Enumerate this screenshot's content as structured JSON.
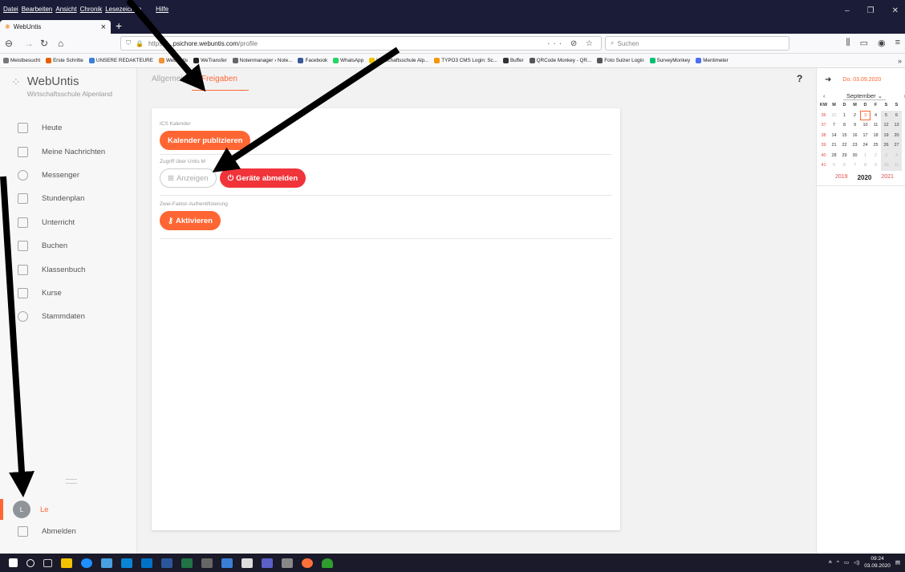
{
  "browser": {
    "menu": [
      "Datei",
      "Bearbeiten",
      "Ansicht",
      "Chronik",
      "Lesezeichen",
      "Hilfe"
    ],
    "tab_title": "WebUntis",
    "url_prefix": "https://",
    "url_host": "...psichore.webuntis.com",
    "url_path": "/profile",
    "search_placeholder": "Suchen",
    "bookmarks": [
      "Meistbesucht",
      "Erste Schritte",
      "UNSERE REDAKTEURE",
      "WebUntis",
      "WeTransfer",
      "Notenmanager › Note...",
      "Facebook",
      "WhatsApp",
      "Wirtschaftsschule Alp...",
      "TYPO3 CMS Login: Sc...",
      "Buffer",
      "QRCode Monkey - QR...",
      "Foto Sulzer Login",
      "SurveyMonkey",
      "Mentimeter"
    ],
    "more": "»"
  },
  "app": {
    "logo_title": "WebUntis",
    "logo_subtitle": "Wirtschaftsschule Alpenland",
    "nav": [
      "Heute",
      "Meine Nachrichten",
      "Messenger",
      "Stundenplan",
      "Unterricht",
      "Buchen",
      "Klassenbuch",
      "Kurse",
      "Stammdaten"
    ],
    "user_initial": "L",
    "user_name": "Le",
    "logout": "Abmelden"
  },
  "tabs": [
    "Allgemein",
    "Freigaben"
  ],
  "help": "?",
  "sections": {
    "ics_title": "ICS Kalender",
    "publish_btn": "Kalender publizieren",
    "access_title": "Zugriff über Untis M",
    "show_btn": "Anzeigen",
    "logout_devices_btn": "Geräte abmelden",
    "twofa_title": "Zwei-Faktor-Authentifizierung",
    "activate_btn": "Aktivieren"
  },
  "calendar": {
    "date": "Do. 03.09.2020",
    "month": "September",
    "headers": [
      "KW",
      "M",
      "D",
      "M",
      "D",
      "F",
      "S",
      "S"
    ],
    "rows": [
      [
        "36",
        "31",
        "1",
        "2",
        "3",
        "4",
        "5",
        "6"
      ],
      [
        "37",
        "7",
        "8",
        "9",
        "10",
        "11",
        "12",
        "13"
      ],
      [
        "38",
        "14",
        "15",
        "16",
        "17",
        "18",
        "19",
        "20"
      ],
      [
        "39",
        "21",
        "22",
        "23",
        "24",
        "25",
        "26",
        "27"
      ],
      [
        "40",
        "28",
        "29",
        "30",
        "1",
        "2",
        "3",
        "4"
      ],
      [
        "41",
        "5",
        "6",
        "7",
        "8",
        "9",
        "10",
        "11"
      ]
    ],
    "years": [
      "2019",
      "2020",
      "2021"
    ]
  },
  "taskbar": {
    "time": "09:24",
    "date": "03.09.2020"
  }
}
